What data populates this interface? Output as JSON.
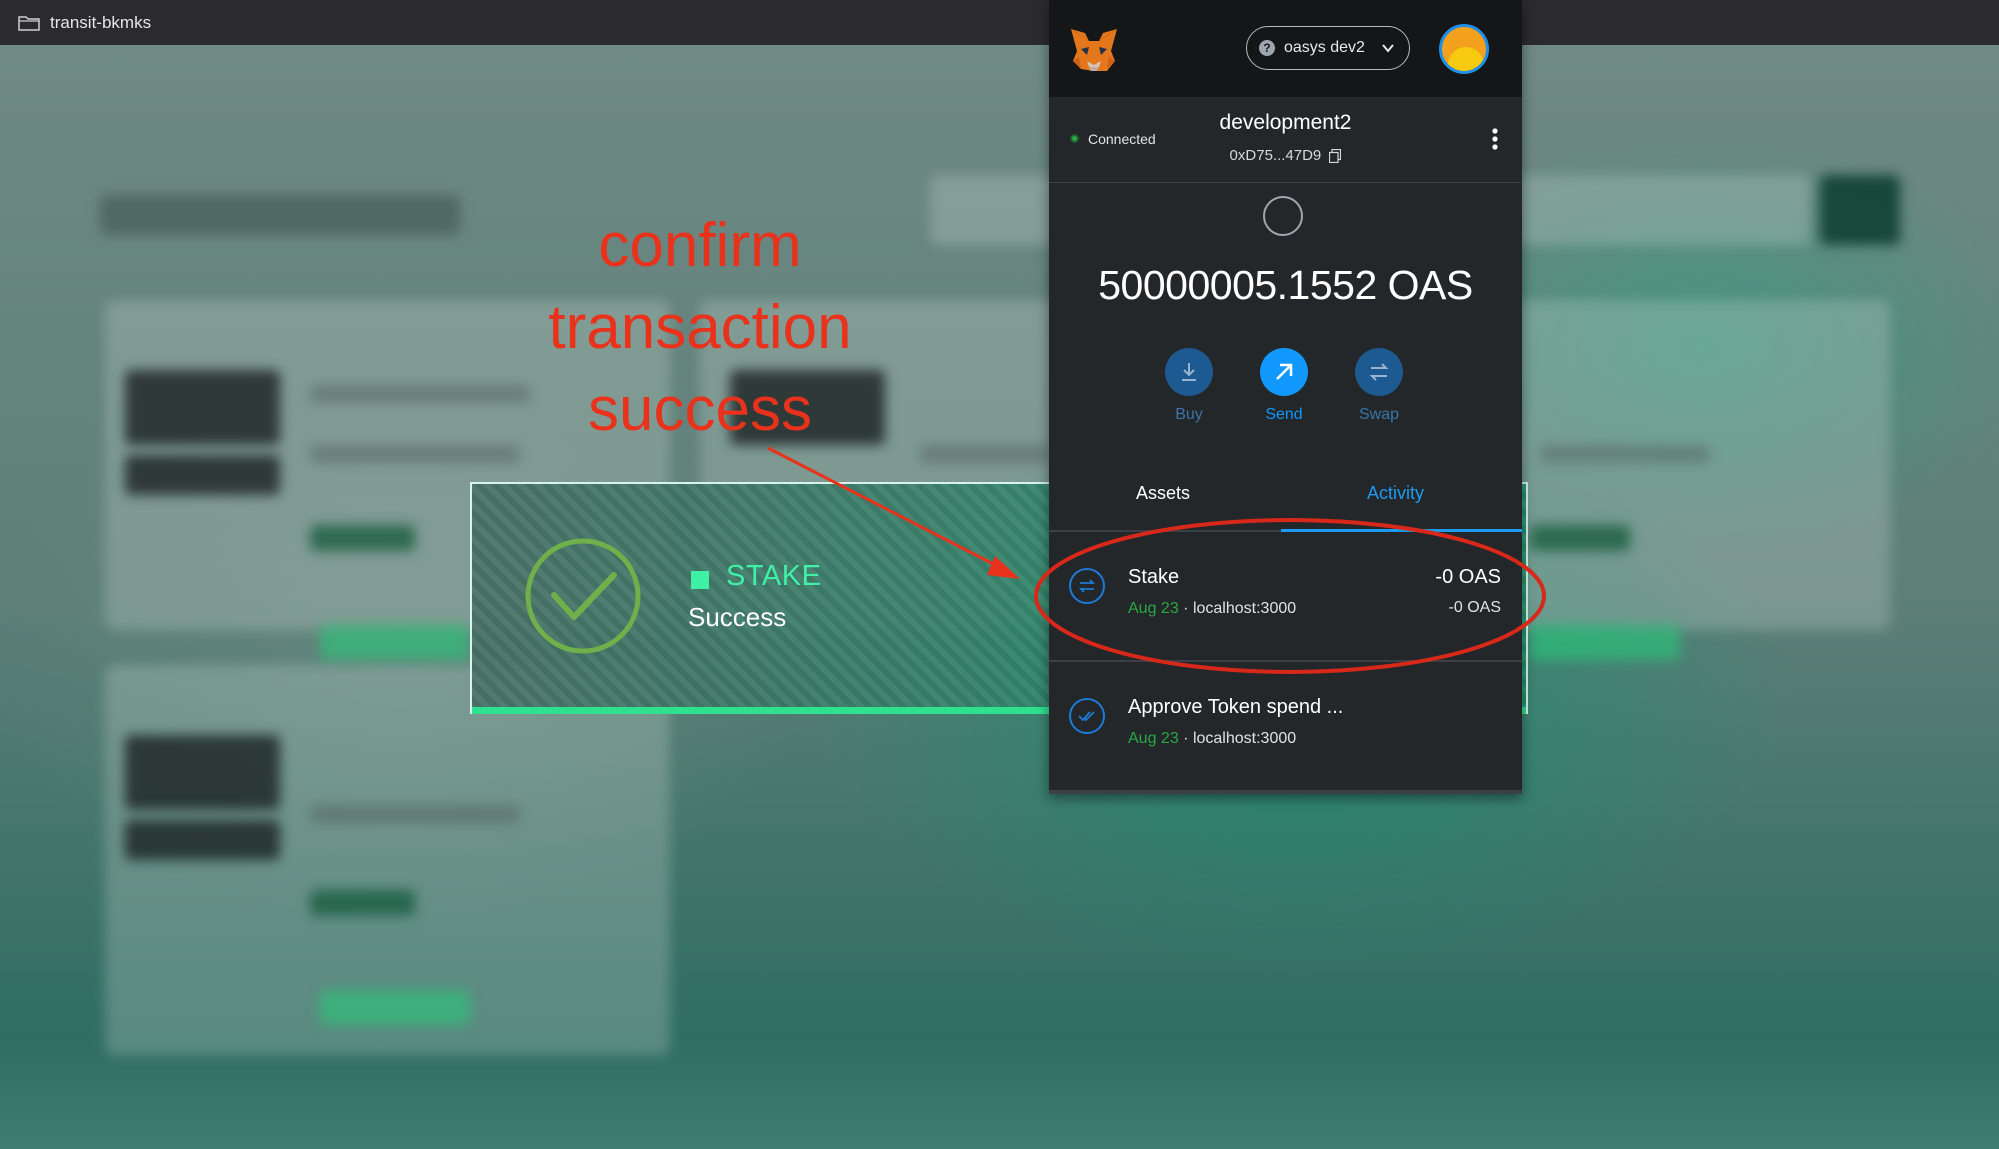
{
  "window": {
    "title": "transit-bkmks"
  },
  "annotation": {
    "lines": [
      "confirm",
      "transaction",
      "success"
    ],
    "color": "#e8321c"
  },
  "toast": {
    "type": "STAKE",
    "message": "Success",
    "accent": "#3ff0a6"
  },
  "metamask": {
    "network": "oasys dev2",
    "network_icon": "?",
    "connection_status": "Connected",
    "account_name": "development2",
    "account_address": "0xD75...47D9",
    "balance": "50000005.1552 OAS",
    "actions": [
      {
        "label": "Buy",
        "icon": "download-icon"
      },
      {
        "label": "Send",
        "icon": "arrow-up-right-icon"
      },
      {
        "label": "Swap",
        "icon": "swap-icon"
      }
    ],
    "tabs": [
      {
        "label": "Assets",
        "active": false
      },
      {
        "label": "Activity",
        "active": true
      }
    ],
    "transactions": [
      {
        "title": "Stake",
        "date": "Aug 23",
        "origin": "localhost:3000",
        "amount": "-0 OAS",
        "amount_secondary": "-0 OAS",
        "icon": "swap-icon"
      },
      {
        "title": "Approve Token spend ...",
        "date": "Aug 23",
        "origin": "localhost:3000",
        "icon": "double-check-icon"
      }
    ],
    "colors": {
      "accent_blue": "#1d9bf0",
      "connected_green": "#28a745"
    }
  }
}
